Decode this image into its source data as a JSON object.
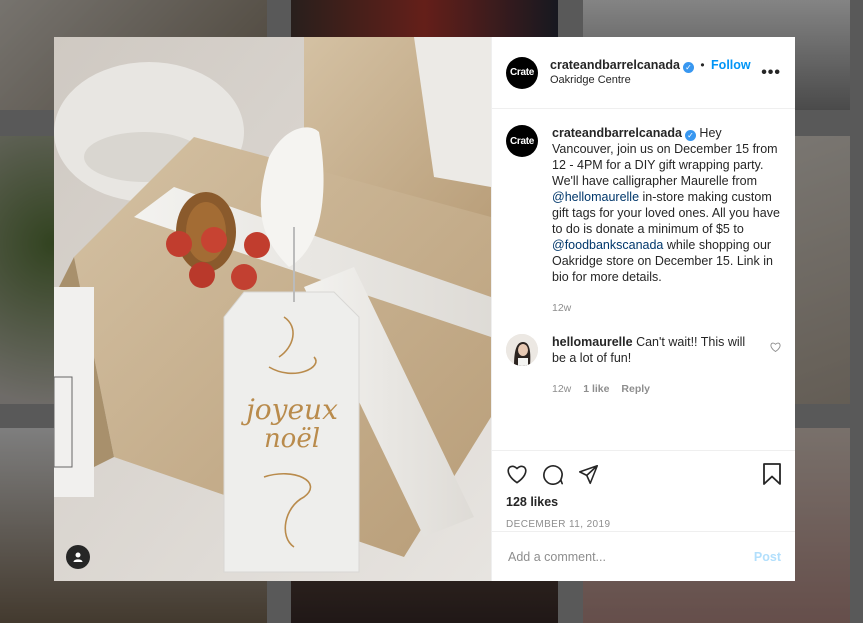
{
  "post": {
    "username": "crateandbarrelcanada",
    "logo_text": "Crate",
    "follow_label": "Follow",
    "dot": "•",
    "location": "Oakridge Centre",
    "more_label": "•••",
    "caption": {
      "part1": "Hey Vancouver, join us on December 15 from 12 - 4PM for a DIY gift wrapping party. We'll have calligrapher Maurelle from ",
      "mention1": "@hellomaurelle",
      "part2": " in-store making custom gift tags for your loved ones. All you have to do is donate a minimum of $5 to ",
      "mention2": "@foodbankscanada",
      "part3": " while shopping our Oakridge store on December 15. Link in bio for more details.",
      "age": "12w"
    },
    "comment": {
      "username": "hellomaurelle",
      "text": "Can't wait!! This will be a lot of fun!",
      "age": "12w",
      "likes": "1 like",
      "reply": "Reply"
    },
    "likes": "128 likes",
    "date": "DECEMBER 11, 2019",
    "add_comment_placeholder": "Add a comment...",
    "post_label": "Post",
    "tag_text": {
      "line1": "joyeux",
      "line2": "noël"
    }
  },
  "colors": {
    "accent": "#0095f6",
    "verified": "#3897f0",
    "mention": "#00376b",
    "muted": "#8e8e8e"
  },
  "icons": [
    "heart-icon",
    "comment-icon",
    "share-icon",
    "bookmark-icon",
    "user-tag-icon",
    "verified-icon"
  ]
}
